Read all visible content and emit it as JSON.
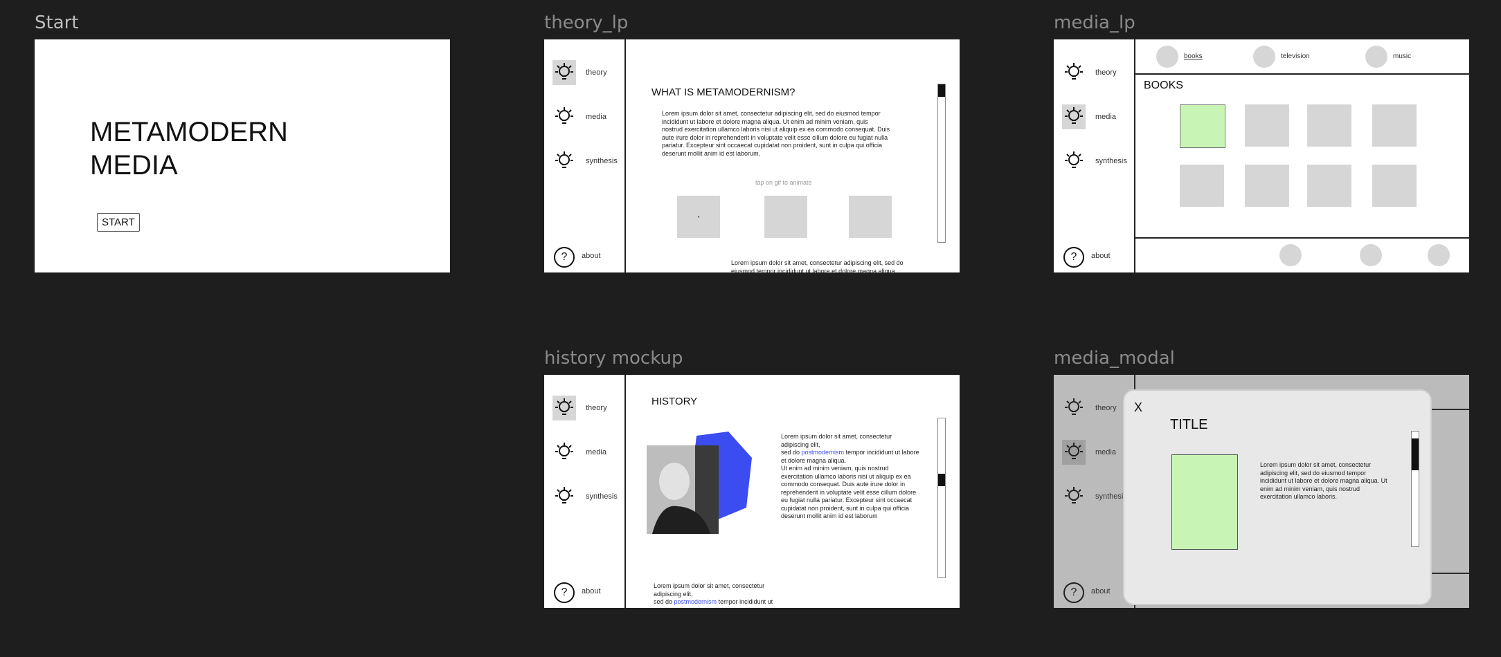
{
  "frames": {
    "start": {
      "label": "Start",
      "title": "METAMODERN\nMEDIA",
      "button": "START"
    },
    "theory": {
      "label": "theory_lp",
      "heading": "WHAT IS METAMODERNISM?",
      "body": "Lorem ipsum dolor sit amet, consectetur adipiscing elit, sed do eiusmod tempor incididunt ut labore et dolore magna aliqua. Ut enim ad minim veniam, quis nostrud exercitation ullamco laboris nisi ut aliquip ex ea commodo consequat. Duis aute irure dolor in reprehenderit in voluptate velit esse cillum dolore eu fugiat nulla pariatur. Excepteur sint occaecat cupidatat non proident, sunt in culpa qui officia deserunt mollit anim id est laborum.",
      "caption": "tap on gif to animate",
      "box_glyph": "▪",
      "footer_text": "Lorem ipsum dolor sit amet, consectetur adipiscing elit, sed do eiusmod tempor incididunt ut labore et dolore magna aliqua."
    },
    "media": {
      "label": "media_lp",
      "header_items": [
        "books",
        "television",
        "music"
      ],
      "section": "BOOKS",
      "tile_colors": [
        "#c8f5b5",
        "#d6d6d6",
        "#d6d6d6",
        "#d6d6d6",
        "#d6d6d6",
        "#d6d6d6",
        "#d6d6d6",
        "#d6d6d6"
      ]
    },
    "history": {
      "label": "history mockup",
      "heading": "HISTORY",
      "body_a": "Lorem ipsum dolor sit amet, consectetur adipiscing elit,",
      "body_b_pre": "sed do ",
      "body_b_link": "postmodernism",
      "body_b_post": " tempor incididunt ut labore et dolore magna aliqua.",
      "body_c": "Ut enim ad minim veniam, quis nostrud exercitation ullamco laboris nisi ut aliquip ex ea commodo consequat. Duis aute irure dolor in reprehenderit in voluptate velit esse cillum dolore eu fugiat nulla pariatur. Excepteur sint occaecat cupidatat non proident, sunt in culpa qui officia deserunt mollit anim id est laborum",
      "footer_a": "Lorem ipsum dolor sit amet, consectetur adipiscing elit,",
      "footer_b_pre": "sed do ",
      "footer_b_link": "postmodernism",
      "footer_b_post": " tempor incididunt ut",
      "accent": "#3b4cf0"
    },
    "modal": {
      "label": "media_modal",
      "close": "X",
      "title": "TITLE",
      "body": "Lorem ipsum dolor sit amet, consectetur adipiscing elit, sed do eiusmod tempor incididunt ut labore et dolore magna aliqua. Ut enim ad minim veniam, quis nostrud exercitation ullamco laboris."
    }
  },
  "sidebar": {
    "items": [
      "theory",
      "media",
      "synthesis"
    ],
    "help_icon": "?",
    "help_label": "about"
  }
}
